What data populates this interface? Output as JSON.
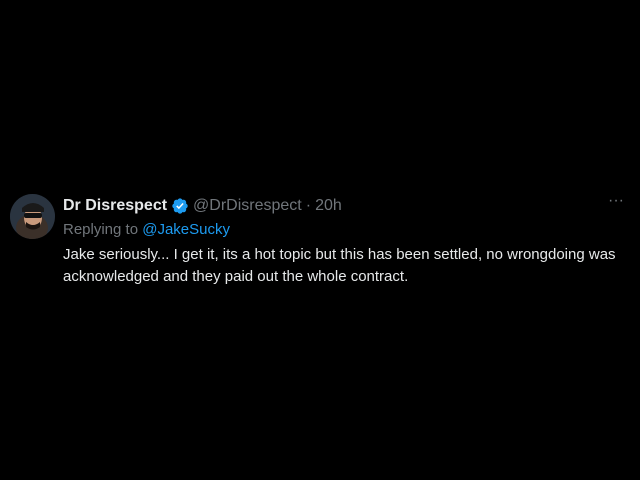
{
  "tweet": {
    "display_name": "Dr Disrespect",
    "handle": "@DrDisrespect",
    "separator": "·",
    "time": "20h",
    "replying_prefix": "Replying to ",
    "replying_to": "@JakeSucky",
    "text": "Jake seriously... I get it, its a hot topic but this has been settled, no wrongdoing was acknowledged and they paid out the whole contract.",
    "more_label": "···",
    "verified_icon": "verified-badge-icon"
  },
  "colors": {
    "background": "#000000",
    "primary_text": "#e7e9ea",
    "secondary_text": "#71767b",
    "accent": "#1d9bf0"
  }
}
